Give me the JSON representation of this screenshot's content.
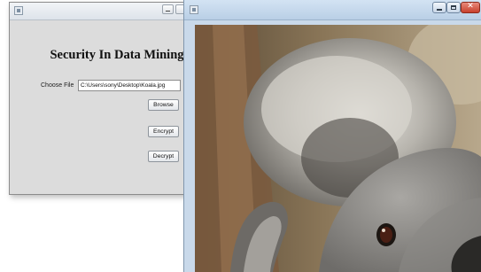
{
  "left_window": {
    "app_title": "Security In Data Mining",
    "choose_file_label": "Choose File",
    "file_path_value": "C:\\Users\\sony\\Desktop\\Koala.jpg",
    "browse_label": "Browse",
    "encrypt_label": "Encrypt",
    "decrypt_label": "Decrypt",
    "icons": [
      "app-icon",
      "minimize-icon",
      "maximize-icon"
    ]
  },
  "right_window": {
    "image_subject": "koala",
    "icons": [
      "app-icon",
      "minimize-icon",
      "maximize-icon",
      "close-icon"
    ],
    "colors": {
      "close_button": "#c7402d",
      "titlebar": "#c9d9ea"
    }
  }
}
